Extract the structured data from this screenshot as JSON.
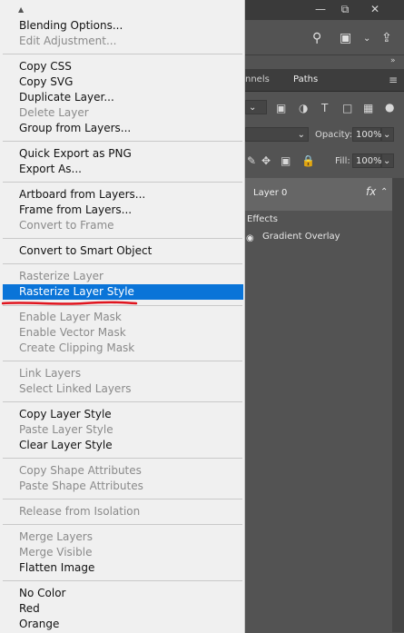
{
  "background_app": {
    "panel_tabs": [
      "nnels",
      "Paths"
    ],
    "opacity_label": "Opacity:",
    "opacity_value": "100%",
    "fill_label": "Fill:",
    "fill_value": "100%",
    "layer_name": "Layer 0",
    "fx_label": "fx",
    "effects_label": "Effects",
    "effect_item": "Gradient Overlay",
    "window_controls": [
      "minimize-icon",
      "restore-icon",
      "close-icon"
    ]
  },
  "menu": {
    "items": [
      {
        "label": "Blending Options...",
        "enabled": true
      },
      {
        "label": "Edit Adjustment...",
        "enabled": false
      },
      {
        "label": "Copy CSS",
        "enabled": true
      },
      {
        "label": "Copy SVG",
        "enabled": true
      },
      {
        "label": "Duplicate Layer...",
        "enabled": true
      },
      {
        "label": "Delete Layer",
        "enabled": false
      },
      {
        "label": "Group from Layers...",
        "enabled": true
      },
      {
        "label": "Quick Export as PNG",
        "enabled": true
      },
      {
        "label": "Export As...",
        "enabled": true
      },
      {
        "label": "Artboard from Layers...",
        "enabled": true
      },
      {
        "label": "Frame from Layers...",
        "enabled": true
      },
      {
        "label": "Convert to Frame",
        "enabled": false
      },
      {
        "label": "Convert to Smart Object",
        "enabled": true
      },
      {
        "label": "Rasterize Layer",
        "enabled": false
      },
      {
        "label": "Rasterize Layer Style",
        "enabled": true,
        "highlighted": true
      },
      {
        "label": "Enable Layer Mask",
        "enabled": false
      },
      {
        "label": "Enable Vector Mask",
        "enabled": false
      },
      {
        "label": "Create Clipping Mask",
        "enabled": false
      },
      {
        "label": "Link Layers",
        "enabled": false
      },
      {
        "label": "Select Linked Layers",
        "enabled": false
      },
      {
        "label": "Copy Layer Style",
        "enabled": true
      },
      {
        "label": "Paste Layer Style",
        "enabled": false
      },
      {
        "label": "Clear Layer Style",
        "enabled": true
      },
      {
        "label": "Copy Shape Attributes",
        "enabled": false
      },
      {
        "label": "Paste Shape Attributes",
        "enabled": false
      },
      {
        "label": "Release from Isolation",
        "enabled": false
      },
      {
        "label": "Merge Layers",
        "enabled": false
      },
      {
        "label": "Merge Visible",
        "enabled": false
      },
      {
        "label": "Flatten Image",
        "enabled": true
      },
      {
        "label": "No Color",
        "enabled": true
      },
      {
        "label": "Red",
        "enabled": true
      },
      {
        "label": "Orange",
        "enabled": true
      }
    ],
    "highlight_color": "#0a74d8",
    "annotation_color": "#e0141e"
  }
}
